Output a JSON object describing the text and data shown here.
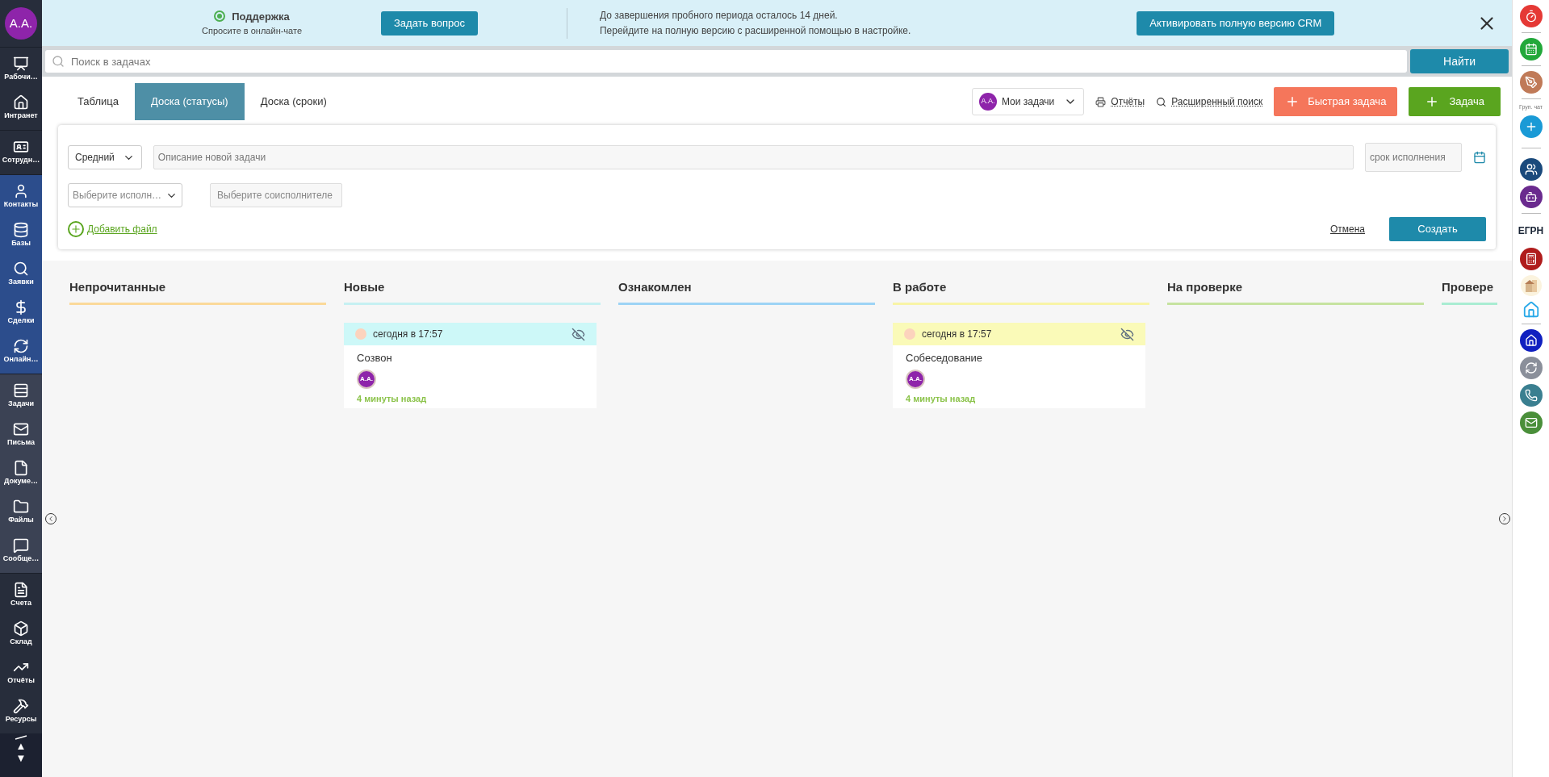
{
  "left_sidebar": {
    "avatar": "A.A.",
    "groups": [
      [
        "Рабочи…",
        "Интранет"
      ],
      [
        "Сотрудн…"
      ],
      [
        "Контакты",
        "Базы",
        "Заявки",
        "Сделки",
        "Онлайн…"
      ],
      [
        "Задачи",
        "Письма",
        "Докуме…",
        "Файлы",
        "Сообще…"
      ],
      [
        "Счета",
        "Склад",
        "Отчёты",
        "Ресурсы"
      ]
    ],
    "scroll_up": "▲",
    "scroll_down": "▼"
  },
  "banner": {
    "support_title": "Поддержка",
    "support_subtitle": "Спросите в онлайн-чате",
    "ask_button": "Задать вопрос",
    "trial_lines": [
      "До завершения пробного периода осталось 14 дней.",
      "Перейдите на полную версию с расширенной помощью в настройке."
    ],
    "activate_button": "Активировать полную версию CRM"
  },
  "search": {
    "placeholder": "Поиск в задачах",
    "button": "Найти"
  },
  "tabs": [
    {
      "label": "Таблица",
      "selected": false
    },
    {
      "label": "Доска (статусы)",
      "selected": true
    },
    {
      "label": "Доска (сроки)",
      "selected": false
    }
  ],
  "toolbar": {
    "filter_avatar": "A.A.",
    "filter": "Мои задачи",
    "reports": "Отчёты",
    "advanced_search": "Расширенный поиск",
    "quick_task": "Быстрая задача",
    "task": "Задача"
  },
  "new_task_form": {
    "priority": "Средний",
    "description_placeholder": "Описание новой задачи",
    "deadline_placeholder": "срок исполнения",
    "assignee_placeholder": "Выберите исполн…",
    "coassignee_placeholder": "Выберите соисполнителе",
    "add_file": "Добавить файл",
    "cancel": "Отмена",
    "create": "Создать"
  },
  "columns": [
    {
      "title": "Непрочитанные",
      "color": "#fbd99a"
    },
    {
      "title": "Новые",
      "color": "#c6f0f2",
      "cards": [
        {
          "time": "сегодня в 17:57",
          "title": "Созвон",
          "avatar": "A.A.",
          "ago": "4 минуты назад",
          "color": "#cdf8f8"
        }
      ]
    },
    {
      "title": "Ознакомлен",
      "color": "#9dd3f5"
    },
    {
      "title": "В работе",
      "color": "#f8f4a6",
      "cards": [
        {
          "time": "сегодня в 17:57",
          "title": "Собеседование",
          "avatar": "A.A.",
          "ago": "4 минуты назад",
          "color": "#fafab8"
        }
      ]
    },
    {
      "title": "На проверке",
      "color": "#c6e3a0"
    },
    {
      "title": "Провере",
      "color": "#a9ecd2"
    }
  ],
  "right_sidebar": {
    "group_chat_label": "Груп. чат",
    "registry_label": "ЕГРН"
  }
}
